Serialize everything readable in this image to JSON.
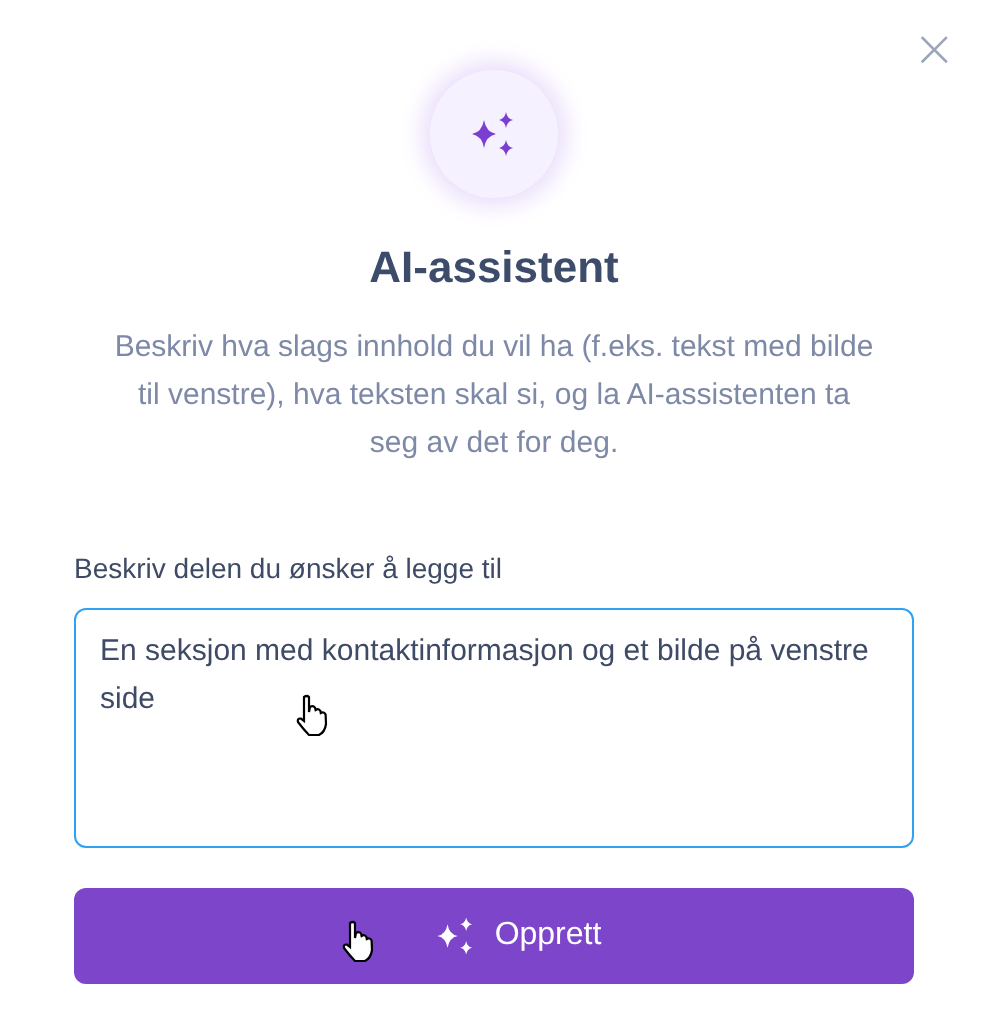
{
  "dialog": {
    "close": "×",
    "title": "AI-assistent",
    "description": "Beskriv hva slags innhold du vil ha (f.eks. tekst med bilde til venstre), hva teksten skal si, og la AI-assistenten ta seg av det for deg."
  },
  "prompt": {
    "label": "Beskriv delen du ønsker å legge til",
    "value": "En seksjon med kontaktinformasjon og et bilde på venstre side"
  },
  "submit": {
    "label": "Opprett"
  }
}
